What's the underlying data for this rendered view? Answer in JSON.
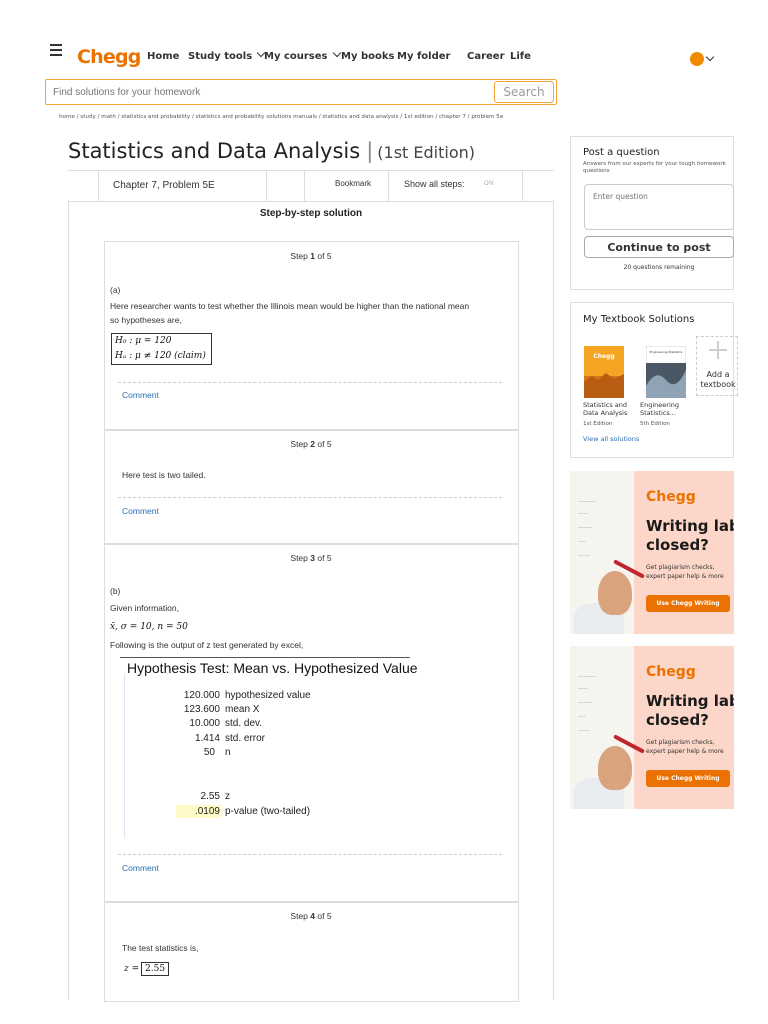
{
  "header": {
    "logo": "Chegg",
    "nav": [
      {
        "label": "Home",
        "has_dropdown": false
      },
      {
        "label": "Study tools",
        "has_dropdown": true
      },
      {
        "label": "My courses",
        "has_dropdown": true
      },
      {
        "label": "My books",
        "has_dropdown": false
      },
      {
        "label": "My folder",
        "has_dropdown": false
      },
      {
        "label": "Career",
        "has_dropdown": false
      },
      {
        "label": "Life",
        "has_dropdown": false
      }
    ]
  },
  "search": {
    "placeholder": "Find solutions for your homework",
    "button_label": "Search"
  },
  "breadcrumb": "home / study / math / statistics and probability / statistics and probability solutions manuals / statistics and data analysis / 1st edition / chapter 7 / problem 5e",
  "book": {
    "title": "Statistics and Data Analysis",
    "edition": "(1st Edition)"
  },
  "problem_bar": {
    "chapter_label": "Chapter 7, Problem 5E",
    "bookmark_label": "Bookmark",
    "show_steps_label": "Show all steps:",
    "toggle_state": "ON"
  },
  "solution": {
    "header": "Step-by-step solution",
    "comment_label": "Comment",
    "step_prefix": "Step",
    "step_of": "of 5",
    "steps": [
      {
        "number": "1",
        "part": "(a)",
        "line1": "Here researcher wants to test whether the Illinois mean would be higher than the national mean",
        "line2": "so hypotheses are,",
        "h0": "H₀ : μ = 120",
        "ha": "Hₐ : μ ≠ 120 (claim)"
      },
      {
        "number": "2",
        "text": "Here test is two tailed."
      },
      {
        "number": "3",
        "part": "(b)",
        "given": "Given information,",
        "given_math": "x̄, σ = 10, n = 50",
        "output_intro": "Following is the output of z test generated by excel,",
        "excel_title": "Hypothesis Test: Mean vs. Hypothesized Value",
        "excel_rows": [
          {
            "value": "120.000",
            "label": "hypothesized value"
          },
          {
            "value": "123.600",
            "label": "mean X"
          },
          {
            "value": "10.000",
            "label": "std. dev."
          },
          {
            "value": "1.414",
            "label": "std. error"
          },
          {
            "value": "50",
            "label": "n"
          },
          {
            "value": "2.55",
            "label": "z"
          },
          {
            "value": ".0109",
            "label": "p-value (two-tailed)"
          }
        ]
      },
      {
        "number": "4",
        "text": "The test statistics is,",
        "z_lhs": "z =",
        "z_value": "2.55"
      }
    ]
  },
  "sidebar": {
    "post": {
      "title": "Post a question",
      "subtitle": "Answers from our experts for your tough homework questions",
      "input_placeholder": "Enter question",
      "button_label": "Continue to post",
      "remaining": "20 questions remaining"
    },
    "textbooks": {
      "title": "My Textbook Solutions",
      "books": [
        {
          "cover_label": "Chegg",
          "caption1": "Statistics and",
          "caption2": "Data Analysis",
          "edition": "1st Edition"
        },
        {
          "cover_label": "Engineering Statistics",
          "caption1": "Engineering",
          "caption2": "Statistics...",
          "edition": "5th Edition"
        }
      ],
      "add_label1": "Add a",
      "add_label2": "textbook",
      "view_all": "View all solutions"
    },
    "ad": {
      "logo": "Chegg",
      "headline1": "Writing lab",
      "headline2": "closed?",
      "sub1": "Get plagiarism checks,",
      "sub2": "expert paper help & more",
      "button": "Use Chegg Writing"
    }
  },
  "colors": {
    "brand_orange": "#eb7100",
    "link_blue": "#2a6fb0",
    "ad_background": "#fcd6c8",
    "highlight_yellow": "#fefbc8"
  }
}
